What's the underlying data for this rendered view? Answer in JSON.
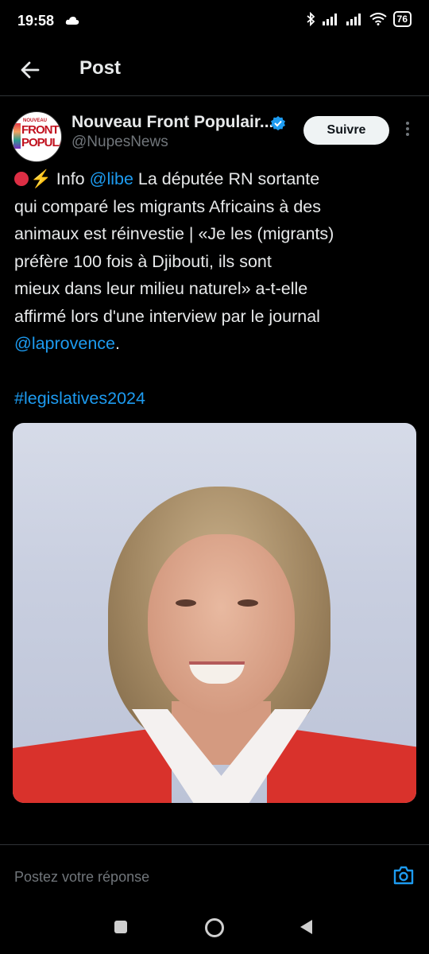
{
  "status_bar": {
    "time": "19:58",
    "battery": "76",
    "icons": [
      "cloud-icon",
      "bluetooth-icon",
      "signal-icon",
      "signal-icon",
      "wifi-icon",
      "battery-icon"
    ]
  },
  "header": {
    "title": "Post",
    "back_icon": "arrow-left-icon"
  },
  "author": {
    "name": "Nouveau Front Populair...",
    "handle": "@NupesNews",
    "verified": true,
    "avatar_text": [
      "NOUVEAU",
      "FRONT",
      "POPULA"
    ],
    "follow_label": "Suivre"
  },
  "tweet": {
    "prefix": "Info",
    "mention1": "@libe",
    "line1_rest": "La députée RN sortante",
    "line2": "qui comparé les migrants Africains à des",
    "line3": "animaux est réinvestie | «Je les (migrants)",
    "line4": "préfère 100 fois à Djibouti, ils sont",
    "line5": "mieux dans leur milieu naturel» a-t-elle",
    "line6": "affirmé lors d'une interview par le journal",
    "mention2": "@laprovence",
    "mention2_suffix": ".",
    "hashtag": "#legislatives2024"
  },
  "composer": {
    "placeholder": "Postez votre réponse",
    "camera_icon": "camera-icon"
  },
  "colors": {
    "background": "#000000",
    "link": "#1d9bf0",
    "text": "#e7e9ea",
    "muted": "#71767b",
    "follow_bg": "#eff3f4"
  }
}
